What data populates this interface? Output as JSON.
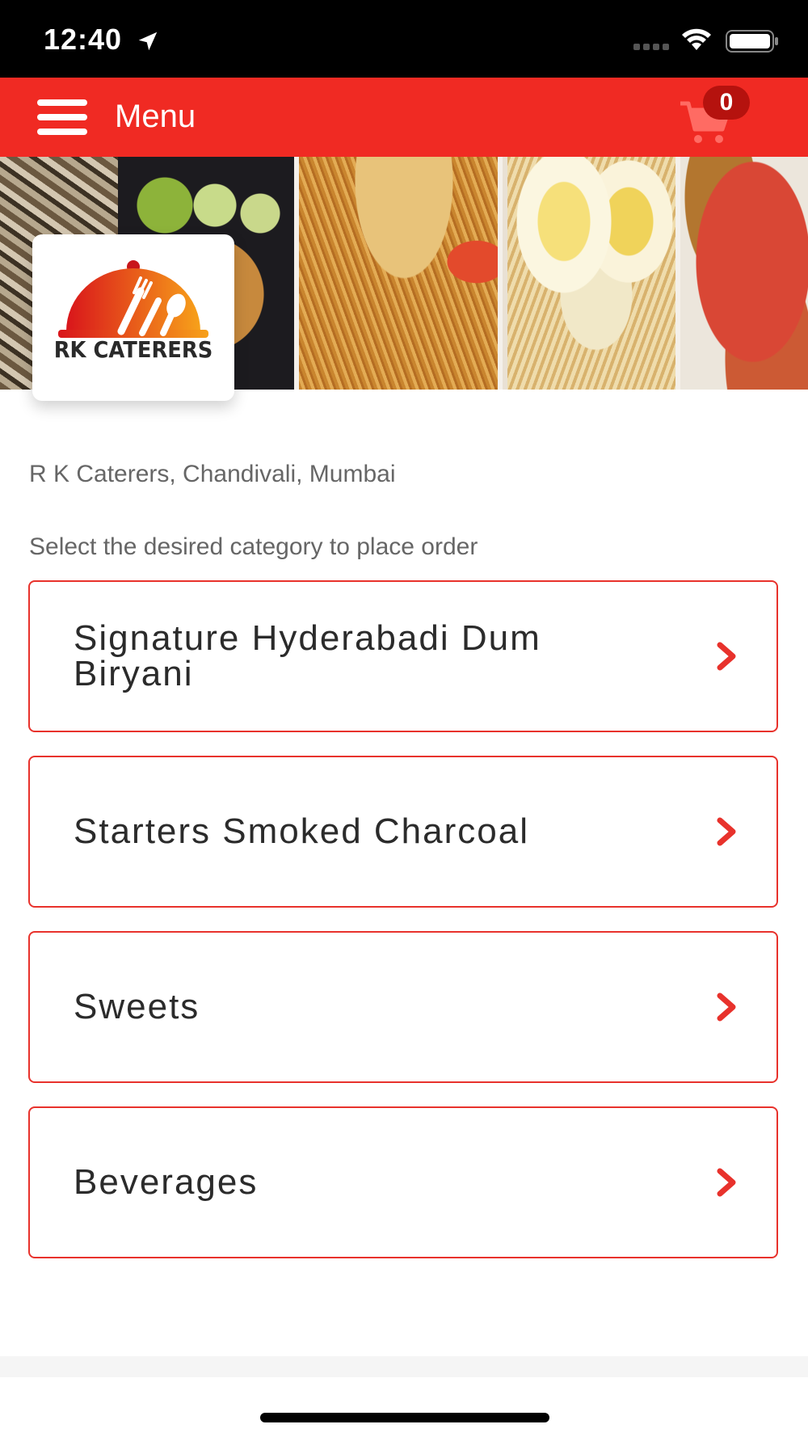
{
  "status_bar": {
    "time": "12:40"
  },
  "app_bar": {
    "title": "Menu",
    "cart_count": "0"
  },
  "restaurant": {
    "logo_text": "RK CATERERS",
    "address": "R K Caterers, Chandivali, Mumbai"
  },
  "instruction": "Select the desired category to place order",
  "categories": [
    {
      "label": "Signature Hyderabadi Dum Biryani"
    },
    {
      "label": "Starters Smoked Charcoal"
    },
    {
      "label": "Sweets"
    },
    {
      "label": "Beverages"
    }
  ],
  "colors": {
    "brand_red": "#f02a23",
    "border_red": "#e8322c",
    "badge_red": "#b5120e",
    "text_gray": "#666666"
  },
  "icons": [
    "location-arrow-icon",
    "cellular-signal-icon",
    "wifi-icon",
    "battery-icon",
    "hamburger-icon",
    "cart-icon",
    "chevron-right-icon"
  ]
}
